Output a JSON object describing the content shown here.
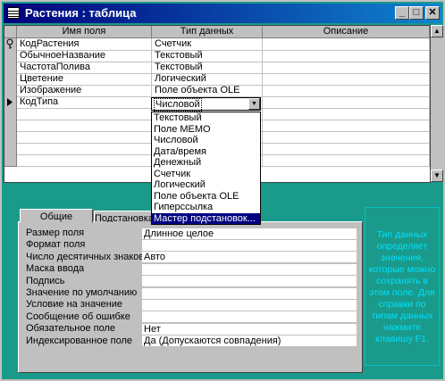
{
  "window": {
    "title": "Растения : таблица"
  },
  "grid": {
    "columns": [
      "Имя поля",
      "Тип данных",
      "Описание"
    ],
    "rows": [
      {
        "name": "КодРастения",
        "type": "Счетчик",
        "key": true
      },
      {
        "name": "ОбычноеНазвание",
        "type": "Текстовый"
      },
      {
        "name": "ЧастотаПолива",
        "type": "Текстовый"
      },
      {
        "name": "Цветение",
        "type": "Логический"
      },
      {
        "name": "Изображение",
        "type": "Поле объекта OLE"
      },
      {
        "name": "КодТипа",
        "type": "Числовой",
        "current": true
      }
    ]
  },
  "dropdown": {
    "items": [
      "Текстовый",
      "Поле MEMO",
      "Числовой",
      "Дата/время",
      "Денежный",
      "Счетчик",
      "Логический",
      "Поле объекта OLE",
      "Гиперссылка",
      "Мастер подстановок..."
    ],
    "highlighted_index": 9
  },
  "tabs": [
    "Общие",
    "Подстановка"
  ],
  "properties": [
    {
      "label": "Размер поля",
      "value": "Длинное целое"
    },
    {
      "label": "Формат поля",
      "value": ""
    },
    {
      "label": "Число десятичных знаков",
      "value": "Авто"
    },
    {
      "label": "Маска ввода",
      "value": ""
    },
    {
      "label": "Подпись",
      "value": ""
    },
    {
      "label": "Значение по умолчанию",
      "value": ""
    },
    {
      "label": "Условие на значение",
      "value": ""
    },
    {
      "label": "Сообщение об ошибке",
      "value": ""
    },
    {
      "label": "Обязательное поле",
      "value": "Нет"
    },
    {
      "label": "Индексированное поле",
      "value": "Да (Допускаются совпадения)"
    }
  ],
  "help_text": "Тип данных определяет значения, которые можно сохранять в этом поле. Для справки по типам данных нажмите клавишу F1."
}
